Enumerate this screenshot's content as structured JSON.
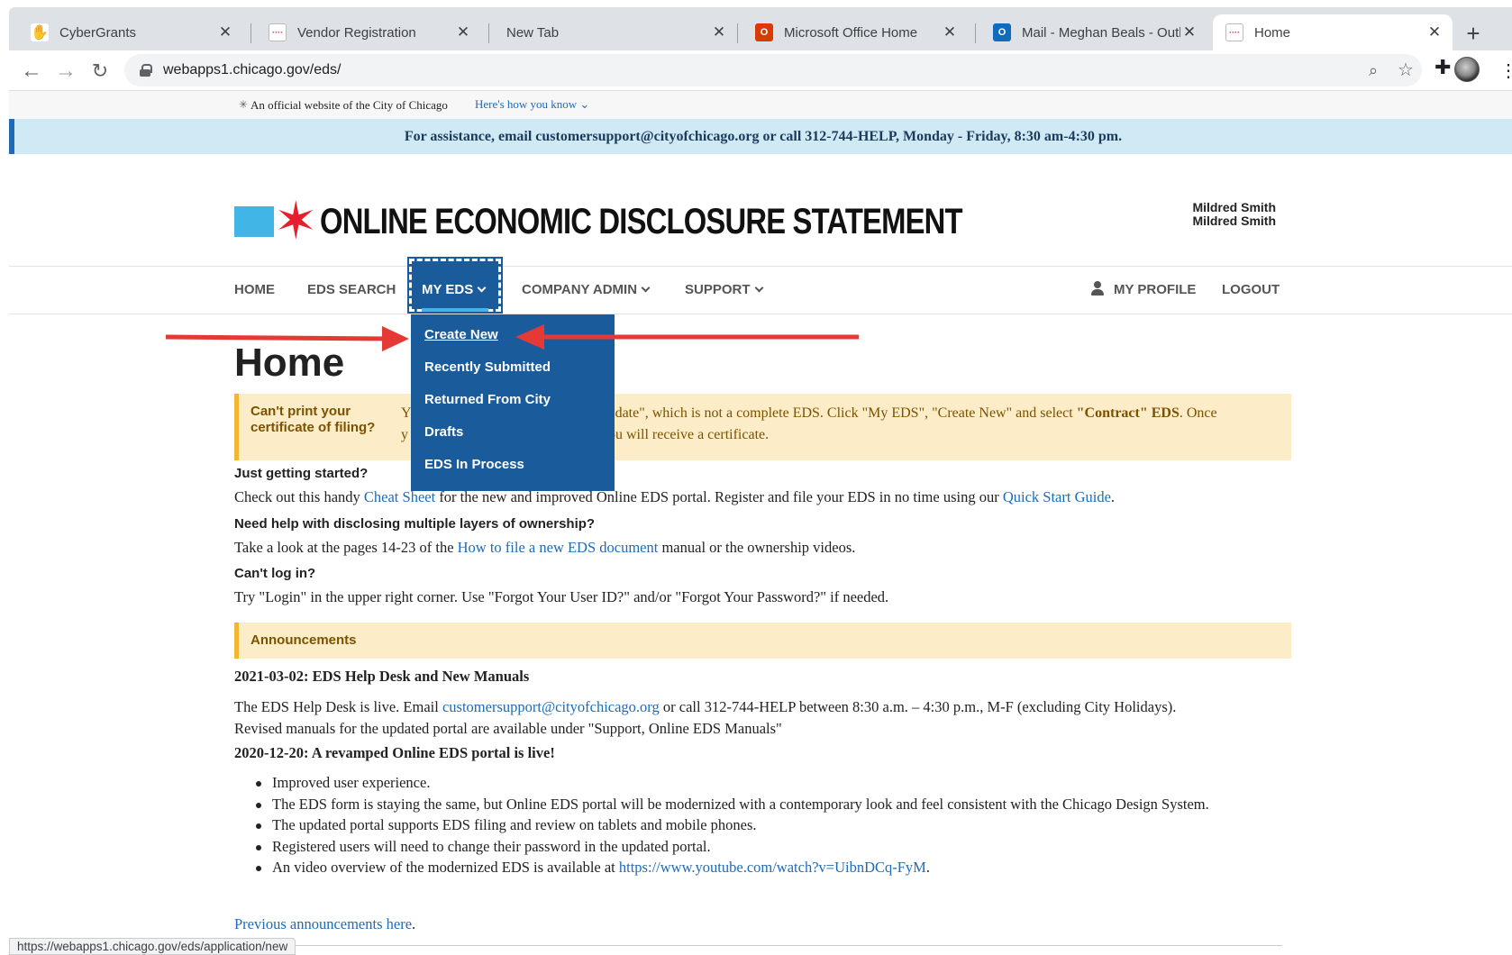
{
  "browser": {
    "tabs": [
      {
        "title": "CyberGrants",
        "icon": "cybergrants-icon",
        "active": false
      },
      {
        "title": "Vendor Registration",
        "icon": "chicago-favicon",
        "active": false
      },
      {
        "title": "New Tab",
        "icon": "",
        "active": false
      },
      {
        "title": "Microsoft Office Home",
        "icon": "office-icon",
        "active": false
      },
      {
        "title": "Mail - Meghan Beals - Outlo",
        "icon": "outlook-icon",
        "active": false
      },
      {
        "title": "Home",
        "icon": "chicago-favicon",
        "active": true
      }
    ],
    "close_glyph": "✕",
    "new_tab_glyph": "+",
    "url": "webapps1.chicago.gov/eds/",
    "status_url": "https://webapps1.chicago.gov/eds/application/new"
  },
  "official_bar": {
    "text": "An official website of the City of Chicago",
    "link": "Here's how you know ⌄"
  },
  "assist_bar": {
    "text": "For assistance, email customersupport@cityofchicago.org or call 312-744-HELP, Monday - Friday, 8:30 am-4:30 pm."
  },
  "header": {
    "title": "ONLINE ECONOMIC DISCLOSURE STATEMENT",
    "user_line1": "Mildred Smith",
    "user_line2": "Mildred Smith"
  },
  "nav": {
    "home": "HOME",
    "eds_search": "EDS SEARCH",
    "my_eds": "MY EDS",
    "company_admin": "COMPANY ADMIN",
    "support": "SUPPORT",
    "my_profile": "MY PROFILE",
    "logout": "LOGOUT"
  },
  "dropdown": {
    "items": [
      "Create New",
      "Recently Submitted",
      "Returned From City",
      "Drafts",
      "EDS In Process"
    ]
  },
  "main": {
    "title": "Home",
    "alert_head": "Can't print your certificate of filing?",
    "alert_body_1": "Y",
    "alert_body_2": "pdate\", which is not a complete EDS. Click \"My EDS\", \"Create New\" and select",
    "alert_body_bold": "\"Contract\" EDS",
    "alert_body_3": ". Once",
    "alert_body_4": "y",
    "alert_body_5": "ou will receive a certificate.",
    "q1_head": "Just getting started?",
    "q1_pre": "Check out this handy",
    "q1_link1": "Cheat Sheet",
    "q1_mid": "for the new and improved Online EDS portal. Register and file your EDS in no time using our",
    "q1_link2": "Quick Start Guide",
    "q1_post": ".",
    "q2_head": "Need help with disclosing multiple layers of ownership?",
    "q2_pre": "Take a look at the pages 14-23 of the",
    "q2_link": "How to file a new EDS document",
    "q2_post": "manual or the ownership videos.",
    "q3_head": "Can't log in?",
    "q3_text": "Try \"Login\" in the upper right corner. Use \"Forgot Your User ID?\" and/or \"Forgot Your Password?\" if needed.",
    "announcements_label": "Announcements",
    "ann1_title": "2021-03-02: EDS Help Desk and New Manuals",
    "ann1_pre": "The EDS Help Desk is live. Email",
    "ann1_link": "customersupport@cityofchicago.org",
    "ann1_post": "or call 312-744-HELP between 8:30 a.m. – 4:30 p.m., M-F (excluding City Holidays).",
    "ann1_line2": "Revised manuals for the updated portal are available under \"Support, Online EDS Manuals\"",
    "ann2_date": "2020-12-20",
    "ann2_title": ": A revamped Online EDS portal is live!",
    "bullets": [
      "Improved user experience.",
      "The EDS form is staying the same, but Online EDS portal will be modernized with a contemporary look and feel consistent with the Chicago Design System.",
      "The updated portal supports EDS filing and review on tablets and mobile phones.",
      "Registered users will need to change their password in the updated portal."
    ],
    "bullet5_pre": "An video overview of the modernized EDS is available at",
    "bullet5_link": "https://www.youtube.com/watch?v=UibnDCq-FyM",
    "bullet5_post": ".",
    "previous_link": "Previous announcements here",
    "previous_post": "."
  },
  "colors": {
    "brand_blue": "#1a5b9c",
    "chicago_light_blue": "#41b6e6",
    "chicago_red": "#e4202f",
    "alert_bg": "#fdecc8",
    "alert_border": "#f2b632",
    "annotation_arrow": "#e53935"
  }
}
